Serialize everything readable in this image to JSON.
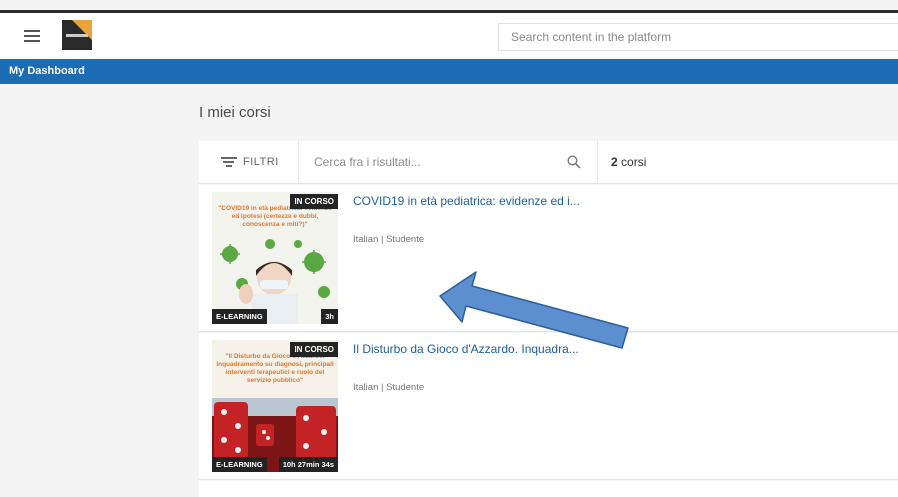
{
  "header": {
    "search_placeholder": "Search content in the platform",
    "logo_icon": "platform-logo"
  },
  "nav": {
    "title": "My Dashboard",
    "color": "#1c6bb5"
  },
  "page": {
    "heading": "I miei corsi"
  },
  "toolbar": {
    "filter_label": "FILTRI",
    "search_placeholder": "Cerca fra i risultati...",
    "count_number": "2",
    "count_label": "corsi"
  },
  "courses": [
    {
      "title": "COVID19 in età pediatrica: evidenze ed i...",
      "meta": "Italian | Studente",
      "status_badge": "IN CORSO",
      "type_badge": "E-LEARNING",
      "duration": "3h",
      "thumb_headline": "\"COVID19 in età pediatrica: evidenze ed ipotesi (certezze e dubbi, conoscenza e miti?)\""
    },
    {
      "title": "Il Disturbo da Gioco d'Azzardo. Inquadra...",
      "meta": "Italian | Studente",
      "status_badge": "IN CORSO",
      "type_badge": "E-LEARNING",
      "duration": "10h 27min 34s",
      "thumb_headline": "\"Il Disturbo da Gioco d'Azzardo. Inquadramento su diagnosi, principali interventi terapeutici e ruolo del servizio pubblico\""
    }
  ],
  "annotation": {
    "arrow_color": "#5b8fd0"
  }
}
